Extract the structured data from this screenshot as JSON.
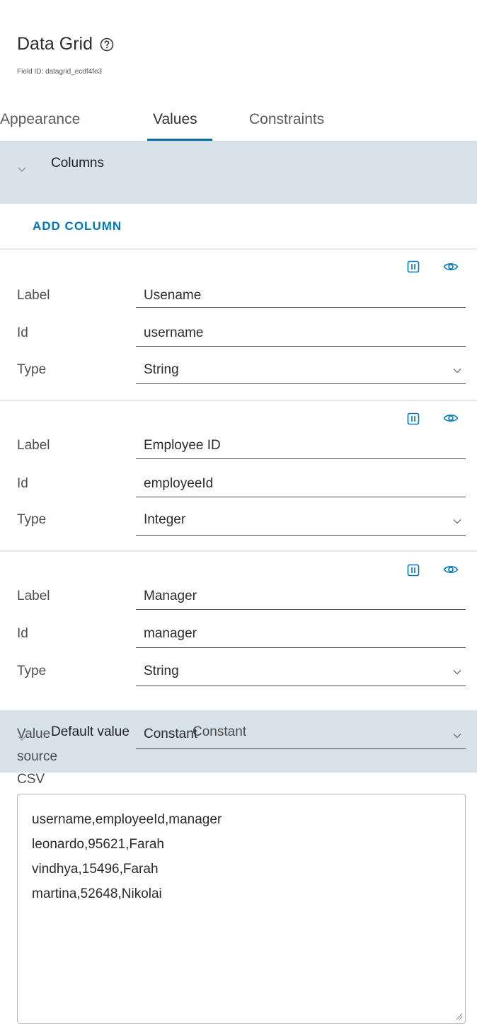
{
  "header": {
    "title": "Data Grid",
    "field_id_label": "Field ID:",
    "field_id_value": "datagrid_ecdf4fe3"
  },
  "tabs": [
    {
      "label": "Appearance",
      "active": false
    },
    {
      "label": "Values",
      "active": true
    },
    {
      "label": "Constraints",
      "active": false
    }
  ],
  "columns_section": {
    "title": "Columns",
    "add_column_label": "ADD COLUMN",
    "columns": [
      {
        "label_caption": "Label",
        "label": "Usename",
        "id_caption": "Id",
        "id": "username",
        "type_caption": "Type",
        "type": "String"
      },
      {
        "label_caption": "Label",
        "label": "Employee ID",
        "id_caption": "Id",
        "id": "employeeId",
        "type_caption": "Type",
        "type": "Integer"
      },
      {
        "label_caption": "Label",
        "label": "Manager",
        "id_caption": "Id",
        "id": "manager",
        "type_caption": "Type",
        "type": "String"
      }
    ]
  },
  "default_value_section": {
    "title": "Default value",
    "summary": "Constant",
    "value_source_label_line1": "Value",
    "value_source_label_line2": "source",
    "value_source": "Constant",
    "csv_label": "CSV",
    "csv_text": "username,employeeId,manager\nleonardo,95621,Farah\nvindhya,15496,Farah\nmartina,52648,Nikolai"
  },
  "colors": {
    "accent": "#0072a3",
    "section_bg": "#d7e2ea",
    "link": "#0079b8"
  },
  "icons": {
    "help": "help-circle-icon",
    "column_settings": "column-settings-icon",
    "visibility": "eye-icon",
    "collapse": "chevron-down-icon"
  }
}
